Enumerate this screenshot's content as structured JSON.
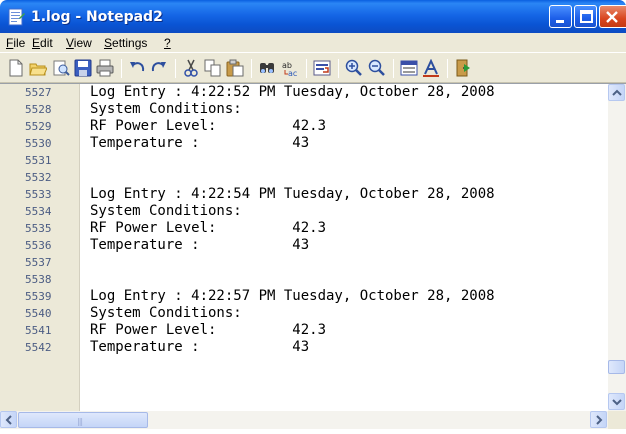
{
  "window": {
    "title": "1.log - Notepad2",
    "icons": {
      "app": "notepad2-app-icon",
      "minimize": "minimize-icon",
      "maximize": "maximize-icon",
      "close": "close-icon"
    },
    "colors": {
      "titlebar": "#0a5fe0",
      "close_button": "#d9461f",
      "chrome": "#ece9d8"
    }
  },
  "menu": {
    "items": [
      {
        "label": "File",
        "mnemonic": "F",
        "rest": "ile"
      },
      {
        "label": "Edit",
        "mnemonic": "E",
        "rest": "dit"
      },
      {
        "label": "View",
        "mnemonic": "V",
        "rest": "iew"
      },
      {
        "label": "Settings",
        "mnemonic": "S",
        "rest": "ettings"
      },
      {
        "label": "?",
        "mnemonic": "?",
        "rest": ""
      }
    ]
  },
  "toolbar": {
    "buttons": [
      "new-file-icon",
      "open-folder-icon",
      "browse-icon",
      "save-icon",
      "print-icon",
      "undo-icon",
      "redo-icon",
      "cut-icon",
      "copy-icon",
      "paste-icon",
      "find-icon",
      "replace-icon",
      "word-wrap-icon",
      "zoom-in-icon",
      "zoom-out-icon",
      "select-scheme-icon",
      "font-icon",
      "exit-icon"
    ]
  },
  "editor": {
    "line_numbers": [
      "5527",
      "5528",
      "5529",
      "5530",
      "5531",
      "5532",
      "5533",
      "5534",
      "5535",
      "5536",
      "5537",
      "5538",
      "5539",
      "5540",
      "5541",
      "5542"
    ],
    "lines": [
      "Log Entry : 4:22:52 PM Tuesday, October 28, 2008",
      "System Conditions:",
      "RF Power Level:         42.3",
      "Temperature :           43",
      "",
      "",
      "Log Entry : 4:22:54 PM Tuesday, October 28, 2008",
      "System Conditions:",
      "RF Power Level:         42.3",
      "Temperature :           43",
      "",
      "",
      "Log Entry : 4:22:57 PM Tuesday, October 28, 2008",
      "System Conditions:",
      "RF Power Level:         42.3",
      "Temperature :           43"
    ],
    "colors": {
      "gutter_text": "#4b5c83",
      "gutter_bg": "#ece9d8"
    }
  },
  "scrollbars": {
    "vertical": {
      "position": 0.93,
      "icons": {
        "up": "scroll-up-icon",
        "down": "scroll-down-icon"
      }
    },
    "horizontal": {
      "position": 0.0,
      "icons": {
        "left": "scroll-left-icon",
        "right": "scroll-right-icon"
      }
    }
  }
}
